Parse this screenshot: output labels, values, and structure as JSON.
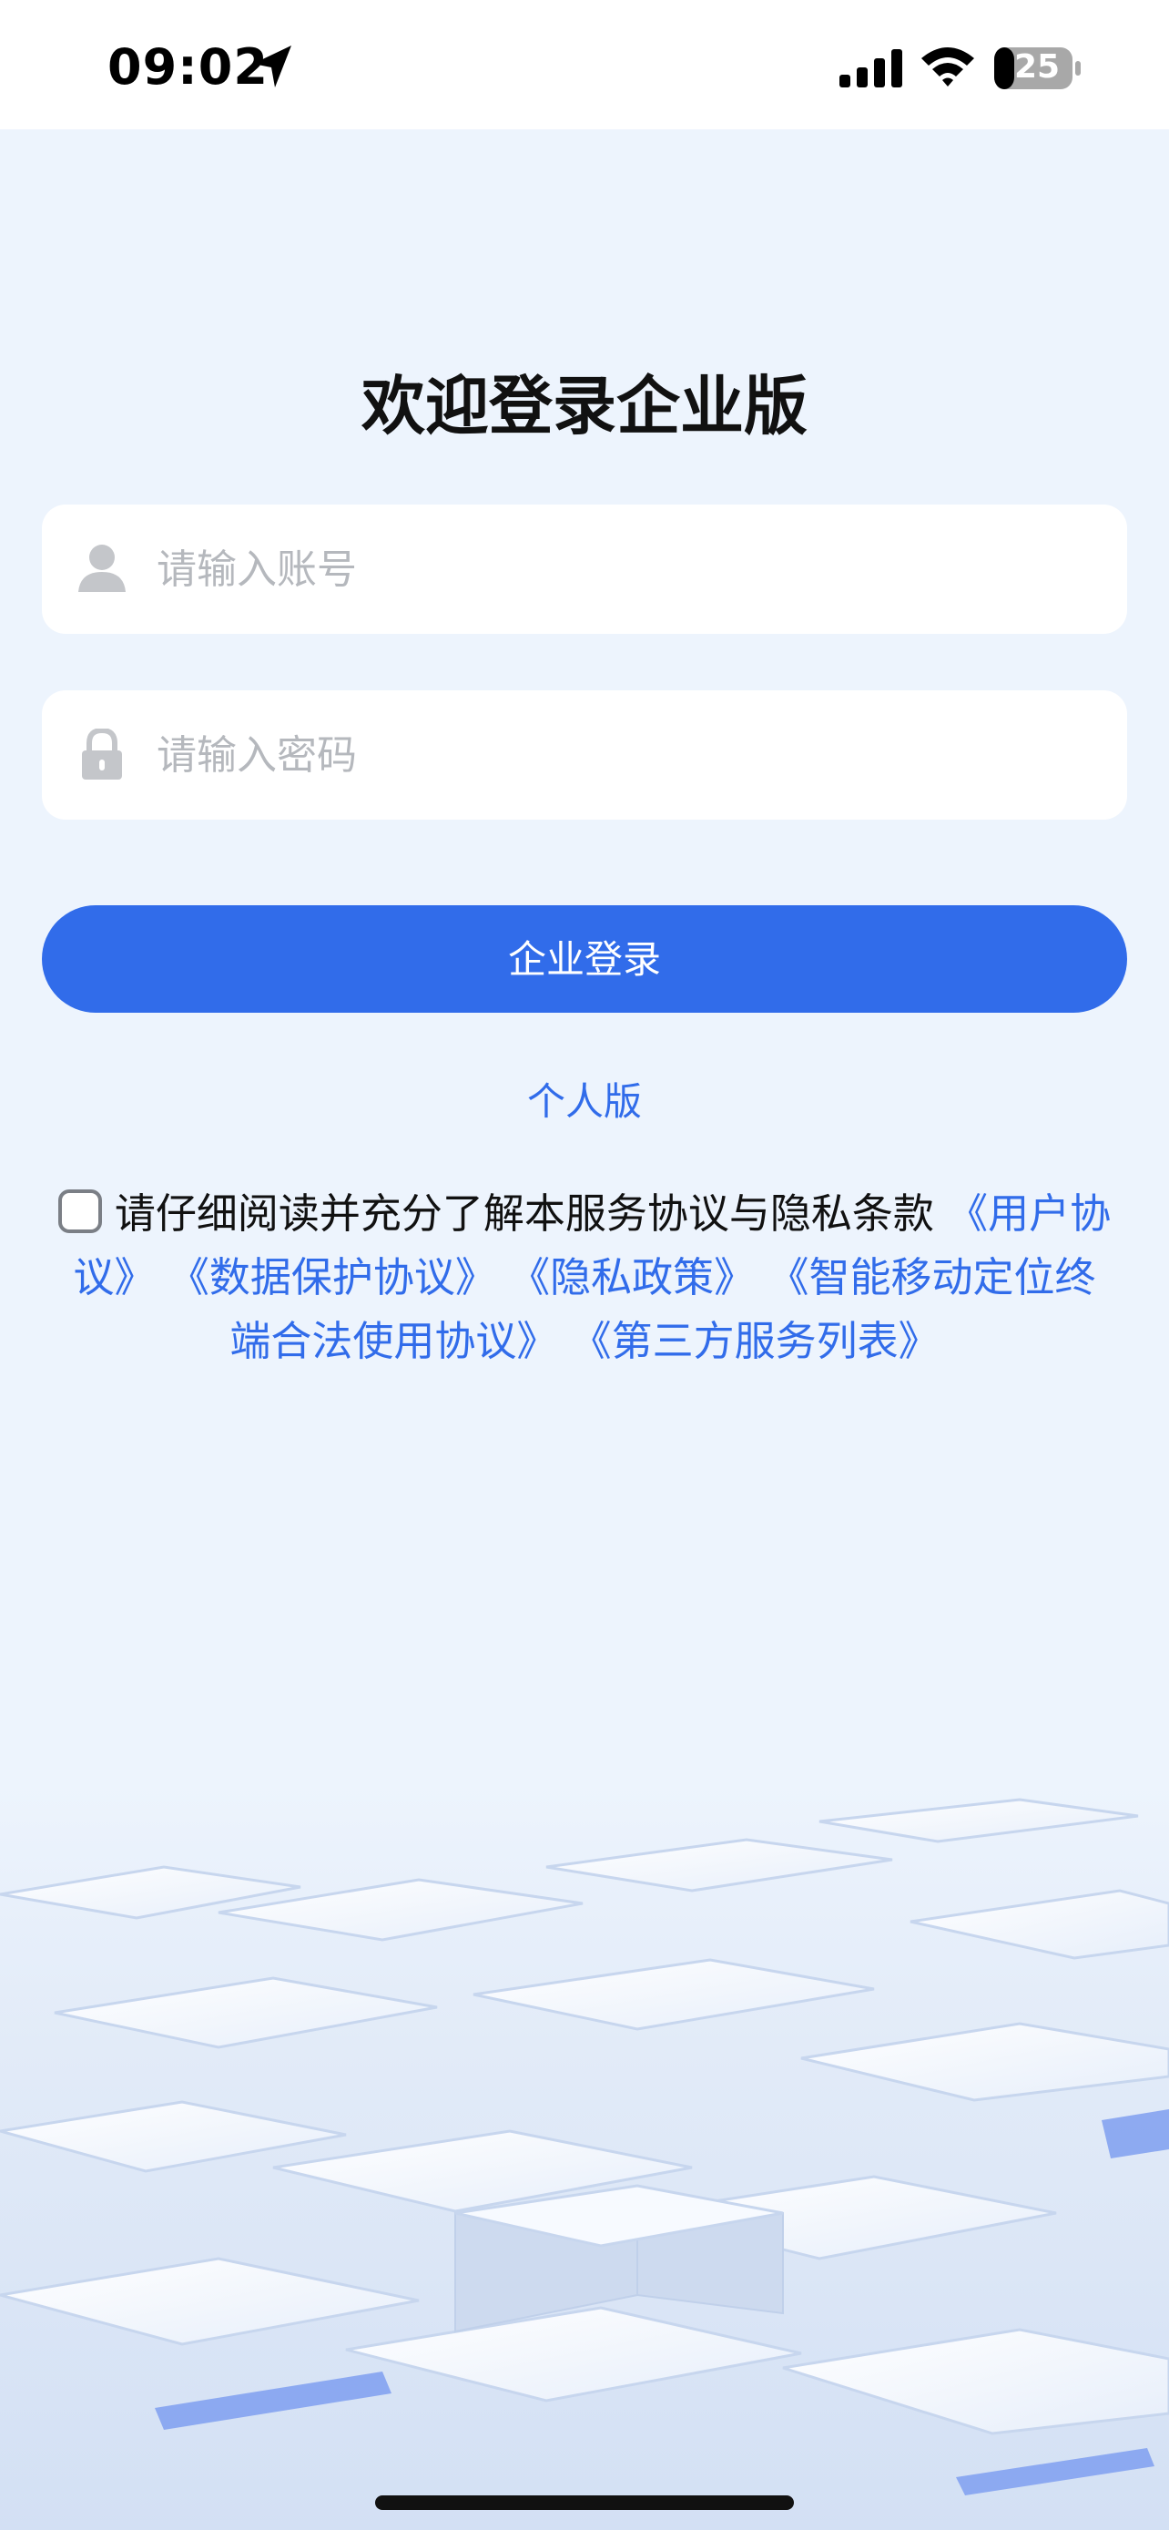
{
  "status_bar": {
    "time": "09:02",
    "battery_level": "25"
  },
  "login": {
    "title": "欢迎登录企业版",
    "account_placeholder": "请输入账号",
    "password_placeholder": "请输入密码",
    "login_button": "企业登录",
    "personal_version_link": "个人版"
  },
  "agreement": {
    "intro": "请仔细阅读并充分了解本服务协议与隐私条款",
    "links": [
      "《用户协议》",
      "《数据保护协议》",
      "《隐私政策》",
      "《智能移动定位终端合法使用协议》",
      "《第三方服务列表》"
    ]
  },
  "colors": {
    "accent": "#316cea",
    "background": "#edf4fd"
  },
  "icons": [
    "location-arrow-icon",
    "cellular-signal-icon",
    "wifi-icon",
    "battery-icon",
    "user-icon",
    "lock-icon"
  ]
}
